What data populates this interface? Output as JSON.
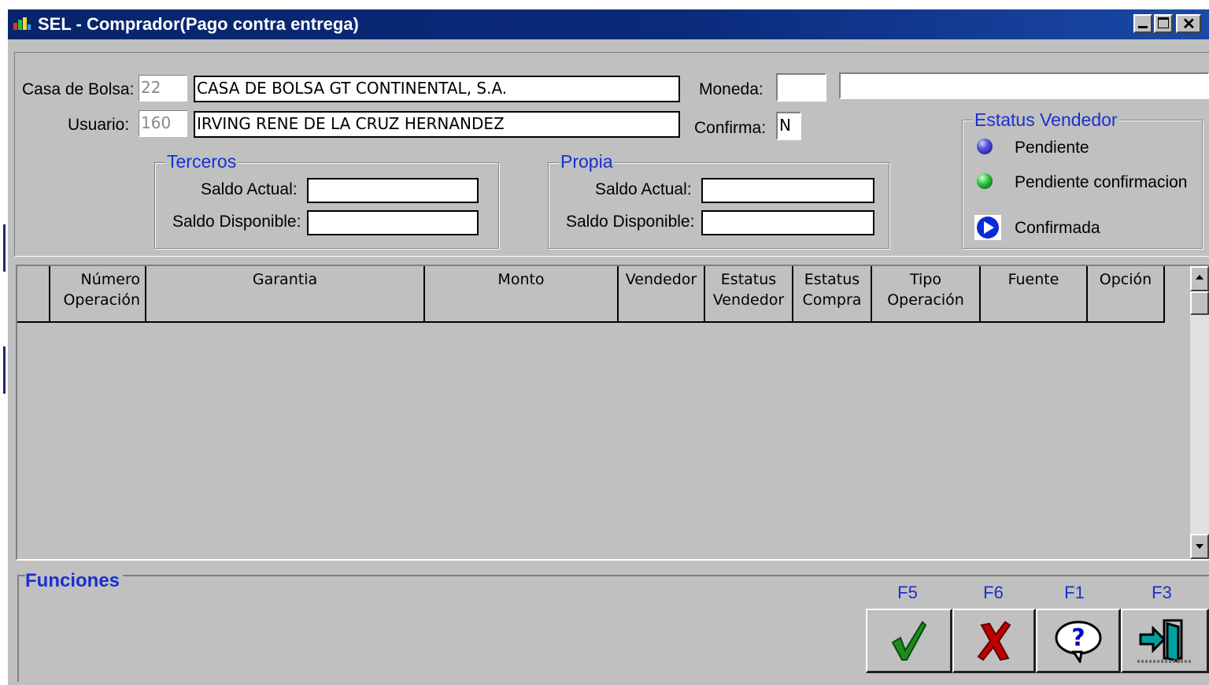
{
  "window": {
    "title": "SEL - Comprador(Pago contra entrega)",
    "controls": [
      "minimize",
      "maximize",
      "close"
    ]
  },
  "header": {
    "casa_label": "Casa de Bolsa:",
    "casa_code": "22",
    "casa_name": "CASA DE BOLSA GT CONTINENTAL, S.A.",
    "usuario_label": "Usuario:",
    "usuario_code": "160",
    "usuario_name": "IRVING RENE DE LA CRUZ HERNANDEZ",
    "moneda_label": "Moneda:",
    "moneda_code": "",
    "moneda_name": "",
    "confirma_label": "Confirma:",
    "confirma_value": "N"
  },
  "terceros": {
    "title": "Terceros",
    "saldo_actual_label": "Saldo Actual:",
    "saldo_actual": "",
    "saldo_disponible_label": "Saldo Disponible:",
    "saldo_disponible": ""
  },
  "propia": {
    "title": "Propia",
    "saldo_actual_label": "Saldo Actual:",
    "saldo_actual": "",
    "saldo_disponible_label": "Saldo Disponible:",
    "saldo_disponible": ""
  },
  "estatus_vendedor": {
    "title": "Estatus Vendedor",
    "items": [
      {
        "label": "Pendiente",
        "icon": "blue-ball-icon"
      },
      {
        "label": "Pendiente confirmacion",
        "icon": "green-ball-icon"
      },
      {
        "label": "Confirmada",
        "icon": "blue-play-icon"
      }
    ]
  },
  "grid": {
    "columns": [
      {
        "l1": "",
        "l2": ""
      },
      {
        "l1": "Número",
        "l2": "Operación"
      },
      {
        "l1": "Garantia",
        "l2": ""
      },
      {
        "l1": "Monto",
        "l2": ""
      },
      {
        "l1": "Vendedor",
        "l2": ""
      },
      {
        "l1": "Estatus",
        "l2": "Vendedor"
      },
      {
        "l1": "Estatus",
        "l2": "Compra"
      },
      {
        "l1": "Tipo",
        "l2": "Operación"
      },
      {
        "l1": "Fuente",
        "l2": ""
      },
      {
        "l1": "Opción",
        "l2": ""
      }
    ],
    "rows": []
  },
  "funciones": {
    "title": "Funciones",
    "buttons": [
      {
        "key": "F5",
        "icon": "checkmark-icon",
        "color": "#1e8c1e"
      },
      {
        "key": "F6",
        "icon": "x-cancel-icon",
        "color": "#c00000"
      },
      {
        "key": "F1",
        "icon": "help-question-icon",
        "color": "#0000c0"
      },
      {
        "key": "F3",
        "icon": "exit-door-icon",
        "color": "#008080"
      }
    ]
  },
  "colors": {
    "titlebar": "#08246b",
    "window_bg": "#c0c0c0",
    "accent_text": "#1a2fd0"
  }
}
